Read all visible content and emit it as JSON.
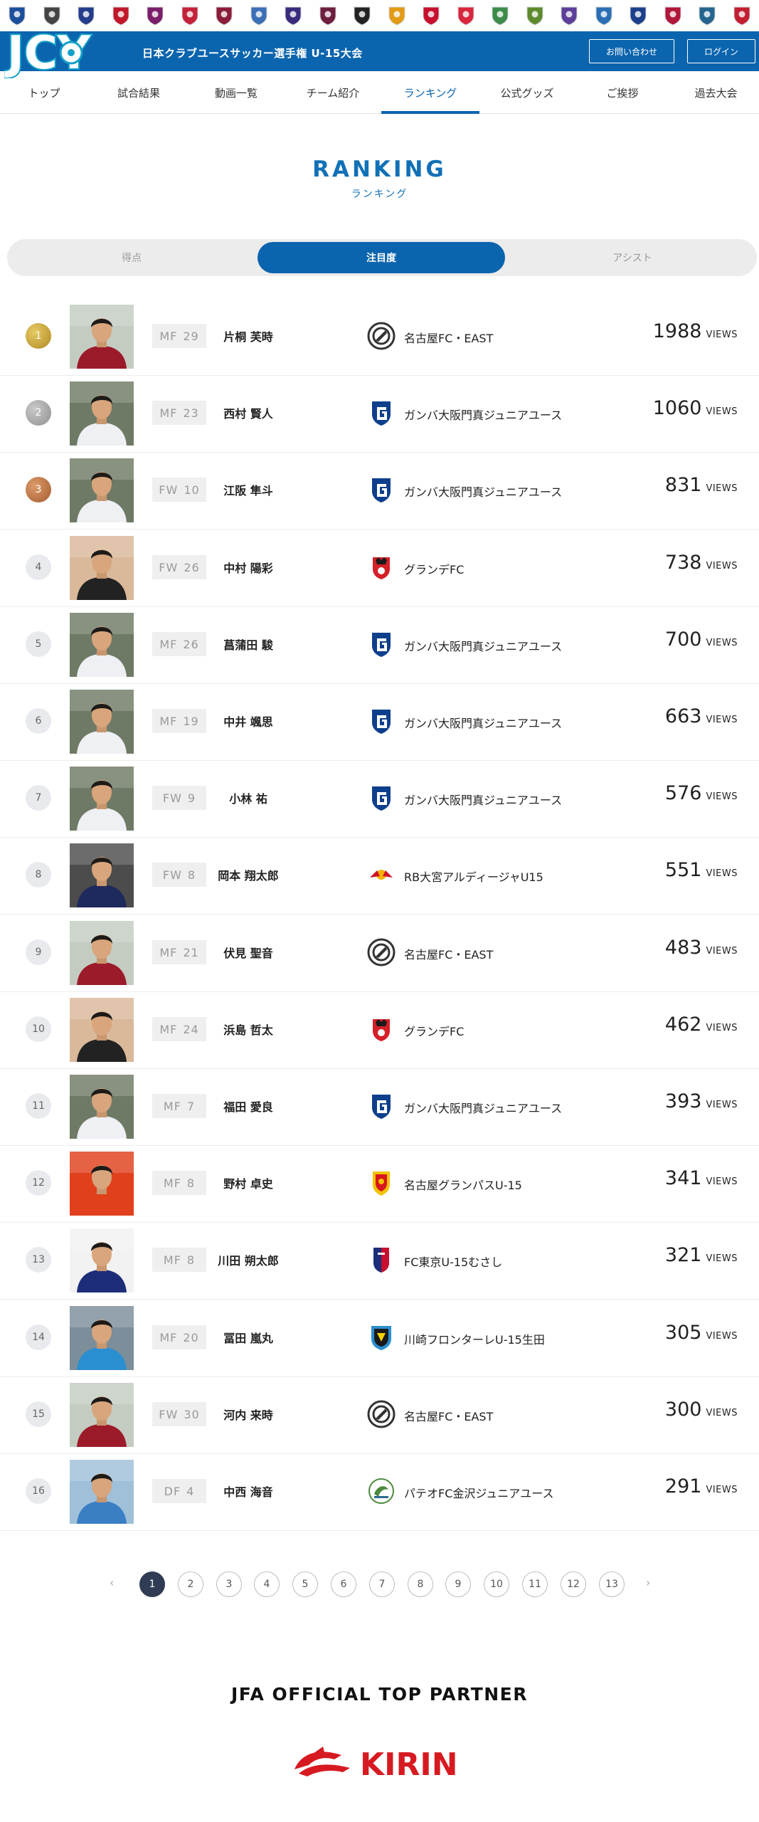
{
  "header": {
    "site_title": "日本クラブユースサッカー選手権 U-15大会",
    "contact_label": "お問い合わせ",
    "login_label": "ログイン",
    "logo_text": "JCY"
  },
  "emblem_strip": {
    "emblems": [
      {
        "icon": "club-emblem-icon",
        "color": "#1c4f9c"
      },
      {
        "icon": "club-emblem-icon",
        "color": "#444444"
      },
      {
        "icon": "club-emblem-icon",
        "color": "#243c8a"
      },
      {
        "icon": "club-emblem-icon",
        "color": "#c0182a"
      },
      {
        "icon": "club-emblem-icon",
        "color": "#7a1d6b"
      },
      {
        "icon": "club-emblem-icon",
        "color": "#c4223a"
      },
      {
        "icon": "club-emblem-icon",
        "color": "#8b1d3b"
      },
      {
        "icon": "club-emblem-icon",
        "color": "#3b6fb6"
      },
      {
        "icon": "club-emblem-icon",
        "color": "#3a2b7d"
      },
      {
        "icon": "club-emblem-icon",
        "color": "#6e1e3f"
      },
      {
        "icon": "club-emblem-icon",
        "color": "#222222"
      },
      {
        "icon": "club-emblem-icon",
        "color": "#e39b16"
      },
      {
        "icon": "club-emblem-icon",
        "color": "#c8102e"
      },
      {
        "icon": "club-emblem-icon",
        "color": "#d7263d"
      },
      {
        "icon": "club-emblem-icon",
        "color": "#3d8b4a"
      },
      {
        "icon": "club-emblem-icon",
        "color": "#5e8a2e"
      },
      {
        "icon": "club-emblem-icon",
        "color": "#5d3f99"
      },
      {
        "icon": "club-emblem-icon",
        "color": "#2a6fb3"
      },
      {
        "icon": "club-emblem-icon",
        "color": "#1b3f8a"
      },
      {
        "icon": "club-emblem-icon",
        "color": "#b0173a"
      },
      {
        "icon": "club-emblem-icon",
        "color": "#25668f"
      },
      {
        "icon": "club-emblem-icon",
        "color": "#c21f32"
      }
    ]
  },
  "nav": {
    "items": [
      {
        "label": "トップ"
      },
      {
        "label": "試合結果"
      },
      {
        "label": "動画一覧"
      },
      {
        "label": "チーム紹介"
      },
      {
        "label": "ランキング",
        "active": true
      },
      {
        "label": "公式グッズ"
      },
      {
        "label": "ご挨拶"
      },
      {
        "label": "過去大会"
      }
    ]
  },
  "page": {
    "title": "RANKING",
    "subtitle": "ランキング"
  },
  "tabs": [
    {
      "label": "得点"
    },
    {
      "label": "注目度",
      "active": true
    },
    {
      "label": "アシスト"
    }
  ],
  "views_unit": "VIEWS",
  "colors": {
    "brand_blue": "#0b64ae",
    "pagination_active": "#2f3c53"
  },
  "ranking": [
    {
      "rank": "1",
      "medal": "gold",
      "position": "MF",
      "number": "29",
      "name": "片桐 芙時",
      "club": "名古屋FC・EAST",
      "club_icon": "nagoya-fc-emblem-icon",
      "views": "1988",
      "kit": "#9b1b2a",
      "bg": "#c4ccc2"
    },
    {
      "rank": "2",
      "medal": "silver",
      "position": "MF",
      "number": "23",
      "name": "西村 賢人",
      "club": "ガンバ大阪門真ジュニアユース",
      "club_icon": "gamba-osaka-emblem-icon",
      "views": "1060",
      "kit": "#eef0f4",
      "bg": "#6f7a66"
    },
    {
      "rank": "3",
      "medal": "bronze",
      "position": "FW",
      "number": "10",
      "name": "江阪 隼斗",
      "club": "ガンバ大阪門真ジュニアユース",
      "club_icon": "gamba-osaka-emblem-icon",
      "views": "831",
      "kit": "#eef0f4",
      "bg": "#6f7a66"
    },
    {
      "rank": "4",
      "medal": "",
      "position": "FW",
      "number": "26",
      "name": "中村 陽彩",
      "club": "グランデFC",
      "club_icon": "grande-fc-emblem-icon",
      "views": "738",
      "kit": "#222222",
      "bg": "#d9b99a"
    },
    {
      "rank": "5",
      "medal": "",
      "position": "MF",
      "number": "26",
      "name": "菖蒲田 駿",
      "club": "ガンバ大阪門真ジュニアユース",
      "club_icon": "gamba-osaka-emblem-icon",
      "views": "700",
      "kit": "#eef0f4",
      "bg": "#6f7a66"
    },
    {
      "rank": "6",
      "medal": "",
      "position": "MF",
      "number": "19",
      "name": "中井 颯思",
      "club": "ガンバ大阪門真ジュニアユース",
      "club_icon": "gamba-osaka-emblem-icon",
      "views": "663",
      "kit": "#eef0f4",
      "bg": "#6f7a66"
    },
    {
      "rank": "7",
      "medal": "",
      "position": "FW",
      "number": "9",
      "name": "小林 祐",
      "club": "ガンバ大阪門真ジュニアユース",
      "club_icon": "gamba-osaka-emblem-icon",
      "views": "576",
      "kit": "#eef0f4",
      "bg": "#6f7a66"
    },
    {
      "rank": "8",
      "medal": "",
      "position": "FW",
      "number": "8",
      "name": "岡本 翔太郎",
      "club": "RB大宮アルディージャU15",
      "club_icon": "rb-omiya-emblem-icon",
      "views": "551",
      "kit": "#1f2a5c",
      "bg": "#4c4c4c"
    },
    {
      "rank": "9",
      "medal": "",
      "position": "MF",
      "number": "21",
      "name": "伏見 聖音",
      "club": "名古屋FC・EAST",
      "club_icon": "nagoya-fc-emblem-icon",
      "views": "483",
      "kit": "#9b1b2a",
      "bg": "#c4ccc2"
    },
    {
      "rank": "10",
      "medal": "",
      "position": "MF",
      "number": "24",
      "name": "浜島 哲太",
      "club": "グランデFC",
      "club_icon": "grande-fc-emblem-icon",
      "views": "462",
      "kit": "#222222",
      "bg": "#d9b99a"
    },
    {
      "rank": "11",
      "medal": "",
      "position": "MF",
      "number": "7",
      "name": "福田 愛良",
      "club": "ガンバ大阪門真ジュニアユース",
      "club_icon": "gamba-osaka-emblem-icon",
      "views": "393",
      "kit": "#eef0f4",
      "bg": "#6f7a66"
    },
    {
      "rank": "12",
      "medal": "",
      "position": "MF",
      "number": "8",
      "name": "野村 卓史",
      "club": "名古屋グランパスU-15",
      "club_icon": "nagoya-grampus-emblem-icon",
      "views": "341",
      "kit": "#e0401c",
      "bg": "#e0401c"
    },
    {
      "rank": "13",
      "medal": "",
      "position": "MF",
      "number": "8",
      "name": "川田 朔太郎",
      "club": "FC東京U-15むさし",
      "club_icon": "fc-tokyo-emblem-icon",
      "views": "321",
      "kit": "#1e2d7a",
      "bg": "#f2f2f2"
    },
    {
      "rank": "14",
      "medal": "",
      "position": "MF",
      "number": "20",
      "name": "冨田 嵐丸",
      "club": "川崎フロンターレU-15生田",
      "club_icon": "kawasaki-frontale-emblem-icon",
      "views": "305",
      "kit": "#2a8fd0",
      "bg": "#7c8e9a"
    },
    {
      "rank": "15",
      "medal": "",
      "position": "FW",
      "number": "30",
      "name": "河内 来時",
      "club": "名古屋FC・EAST",
      "club_icon": "nagoya-fc-emblem-icon",
      "views": "300",
      "kit": "#9b1b2a",
      "bg": "#c4ccc2"
    },
    {
      "rank": "16",
      "medal": "",
      "position": "DF",
      "number": "4",
      "name": "中西 海音",
      "club": "パテオFC金沢ジュニアユース",
      "club_icon": "pateo-fc-emblem-icon",
      "views": "291",
      "kit": "#3a7fc4",
      "bg": "#9fc0d8"
    }
  ],
  "pagination": {
    "prev": "‹",
    "next": "›",
    "pages": [
      "1",
      "2",
      "3",
      "4",
      "5",
      "6",
      "7",
      "8",
      "9",
      "10",
      "11",
      "12",
      "13"
    ],
    "current": "1"
  },
  "partner": {
    "title": "JFA OFFICIAL TOP PARTNER",
    "logo_text": "KIRIN"
  }
}
